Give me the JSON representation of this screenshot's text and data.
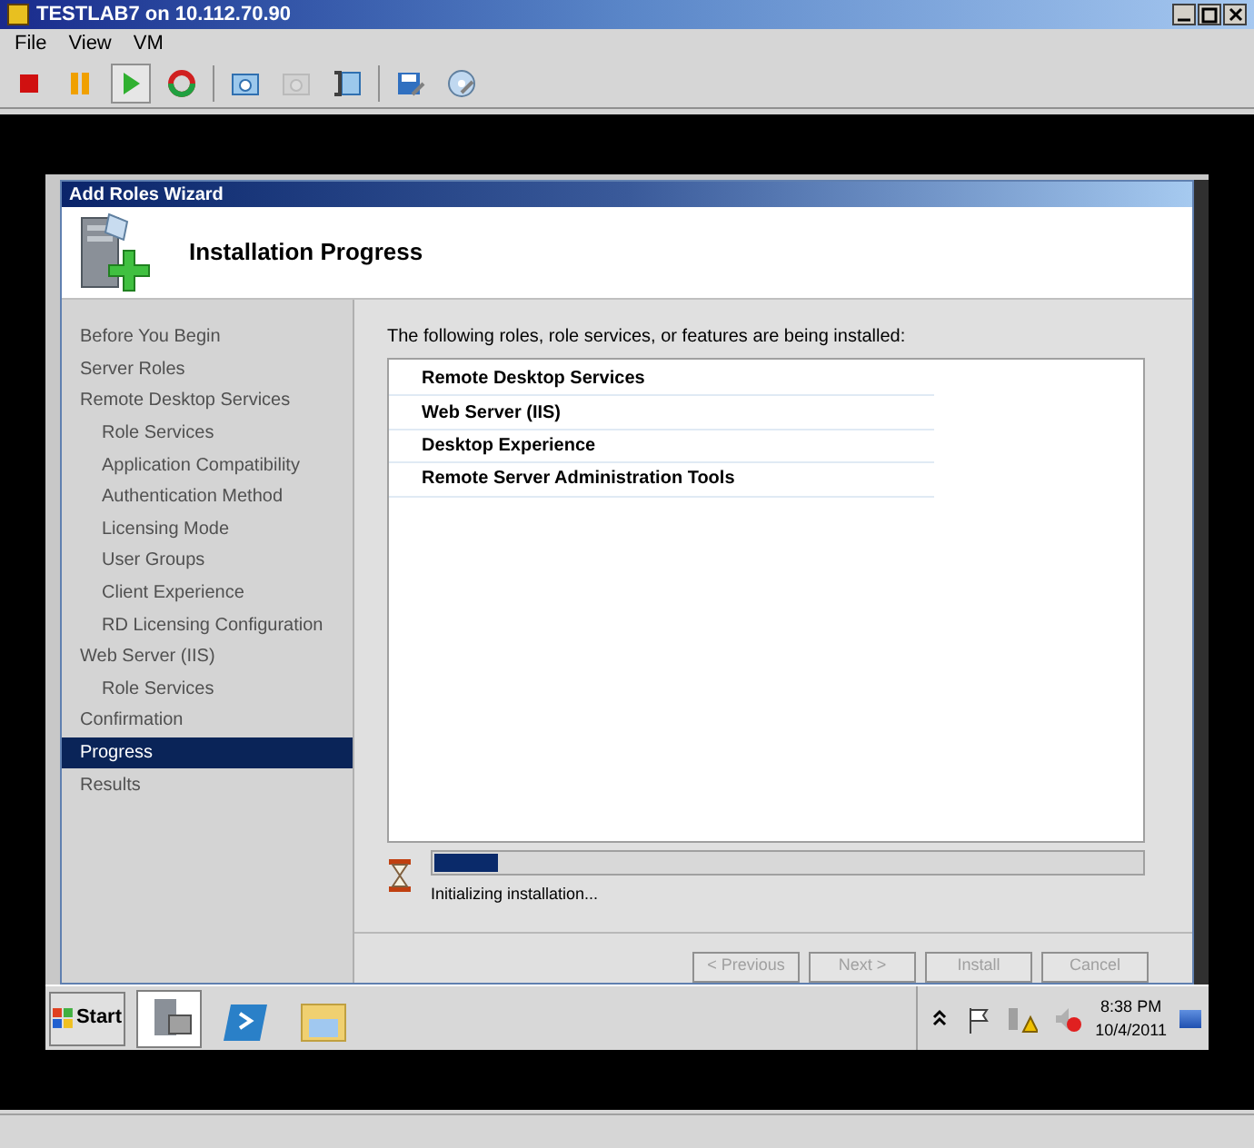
{
  "window": {
    "title": "TESTLAB7 on 10.112.70.90"
  },
  "menu": [
    "File",
    "View",
    "VM"
  ],
  "toolbar": [
    {
      "pressed": false,
      "disabled": false
    },
    {
      "pressed": false,
      "disabled": false
    },
    {
      "pressed": true,
      "disabled": false
    },
    {
      "pressed": false,
      "disabled": false
    },
    {
      "pressed": false,
      "disabled": false
    },
    {
      "pressed": false,
      "disabled": true
    },
    {
      "pressed": false,
      "disabled": false
    },
    {
      "pressed": false,
      "disabled": false
    },
    {
      "pressed": false,
      "disabled": false
    }
  ],
  "wizard": {
    "title": "Add Roles Wizard",
    "heading": "Installation Progress",
    "steps": [
      {
        "label": "Before You Begin",
        "selected": false
      },
      {
        "label": "Server Roles",
        "selected": false
      },
      {
        "label": "Remote Desktop Services",
        "selected": false,
        "children": [
          {
            "label": "Role Services",
            "selected": false
          },
          {
            "label": "Application Compatibility",
            "selected": false
          },
          {
            "label": "Authentication Method",
            "selected": false
          },
          {
            "label": "Licensing Mode",
            "selected": false
          },
          {
            "label": "User Groups",
            "selected": false
          },
          {
            "label": "Client Experience",
            "selected": false
          },
          {
            "label": "RD Licensing Configuration",
            "selected": false
          }
        ]
      },
      {
        "label": "Web Server (IIS)",
        "selected": false,
        "children": [
          {
            "label": "Role Services",
            "selected": false
          }
        ]
      },
      {
        "label": "Confirmation",
        "selected": false
      },
      {
        "label": "Progress",
        "selected": true
      },
      {
        "label": "Results",
        "selected": false
      }
    ],
    "intro": "The following roles, role services, or features are being installed:",
    "items": [
      "Remote Desktop Services",
      "Web Server (IIS)",
      "Desktop Experience",
      "Remote Server Administration Tools"
    ],
    "progress": {
      "level": 0.09,
      "status": "Initializing installation..."
    },
    "buttons": [
      {
        "label": "< Previous",
        "disabled": true
      },
      {
        "label": "Next >",
        "disabled": true
      },
      {
        "label": "Install",
        "disabled": true
      },
      {
        "label": "Cancel",
        "disabled": true
      }
    ]
  },
  "taskbar": {
    "start": "Start",
    "apps": [
      {
        "selected": true
      },
      {
        "selected": false
      },
      {
        "selected": false
      }
    ],
    "time": "8:38 PM",
    "date": "10/4/2011"
  }
}
